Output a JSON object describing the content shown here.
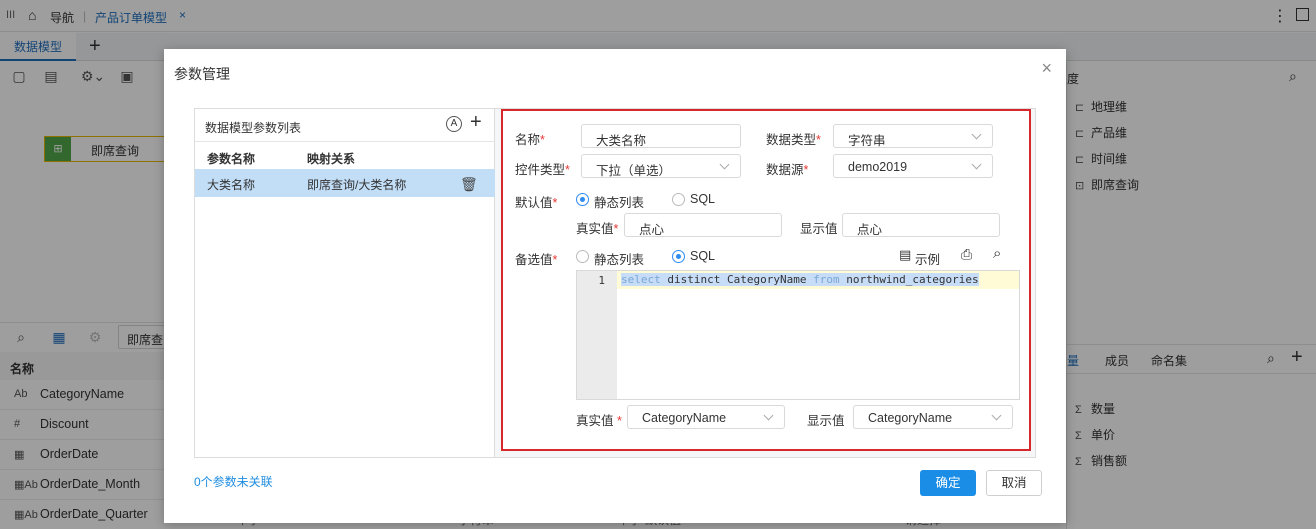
{
  "topbar": {
    "menu_icon": "III",
    "home_label": "导航",
    "tab_label": "产品订单模型",
    "tab_close": "×",
    "more_icon": "⋮"
  },
  "tabs": {
    "active": "数据模型",
    "add": "+"
  },
  "canvas": {
    "node_label": "即席查询"
  },
  "bottom": {
    "search_box": "即席查",
    "field_header": "名称",
    "fields": [
      {
        "icon": "Ab",
        "name": "CategoryName"
      },
      {
        "icon": "#",
        "name": "Discount"
      },
      {
        "icon": "▦",
        "name": "OrderDate"
      },
      {
        "icon": "▦Ab",
        "name": "OrderDate_Month"
      },
      {
        "icon": "▦Ab",
        "name": "OrderDate_Quarter"
      }
    ],
    "peek": [
      "年季",
      "字符串",
      "<年季-默认值>",
      "请选择"
    ]
  },
  "right_panel": {
    "title": "度",
    "dimensions": [
      "地理维",
      "产品维",
      "时间维",
      "即席查询"
    ],
    "tabs": [
      "量",
      "成员",
      "命名集"
    ],
    "measures": [
      "数量",
      "单价",
      "销售额"
    ]
  },
  "dialog": {
    "title": "参数管理",
    "close": "×",
    "list": {
      "title": "数据模型参数列表",
      "sort_icon": "A",
      "add": "+",
      "col_name": "参数名称",
      "col_map": "映射关系",
      "row_name": "大类名称",
      "row_map": "即席查询/大类名称"
    },
    "form": {
      "name_label": "名称",
      "name_value": "大类名称",
      "dtype_label": "数据类型",
      "dtype_value": "字符串",
      "ctrl_label": "控件类型",
      "ctrl_value": "下拉（单选）",
      "source_label": "数据源",
      "source_value": "demo2019",
      "default_label": "默认值",
      "opt_static": "静态列表",
      "opt_sql": "SQL",
      "real_label": "真实值",
      "real_value": "点心",
      "display_label": "显示值",
      "display_value": "点心",
      "alt_label": "备选值",
      "example_label": "示例",
      "sql_line_no": "1",
      "sql_kw1": "select",
      "sql_mid": " distinct CategoryName ",
      "sql_kw2": "from",
      "sql_tail": " northwind_categories",
      "alt_real_label": "真实值",
      "alt_real_value": "CategoryName",
      "alt_display_label": "显示值",
      "alt_display_value": "CategoryName",
      "required_mark": "*"
    },
    "footer_link": "0个参数未关联",
    "ok": "确定",
    "cancel": "取消"
  }
}
